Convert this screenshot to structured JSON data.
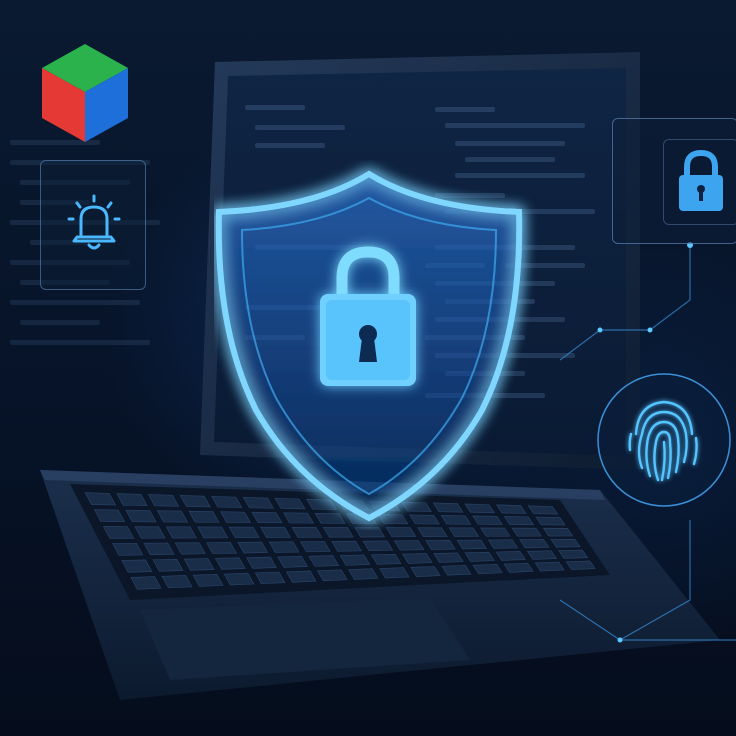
{
  "scene": {
    "description_icons": {
      "logo": "rgb-cube-icon",
      "notification": "bell-icon",
      "lock_card": "padlock-icon",
      "shield": "shield-icon",
      "shield_lock": "padlock-icon",
      "biometric": "fingerprint-icon",
      "device": "laptop"
    },
    "colors": {
      "background": "#06101f",
      "glow": "#4fc3ff",
      "glow_strong": "#8fe0ff",
      "cube_top": "#2bb24c",
      "cube_left": "#e53935",
      "cube_right": "#1e6fd9"
    }
  }
}
